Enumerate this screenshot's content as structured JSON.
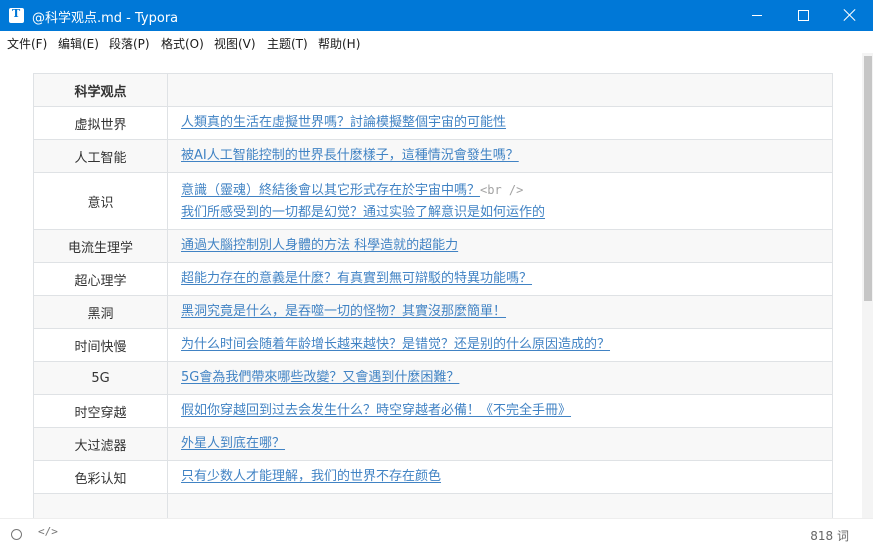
{
  "window": {
    "title": "@科学观点.md - Typora",
    "icon_letter": "T",
    "minimize_icon": "minimize-icon",
    "maximize_icon": "maximize-icon",
    "close_icon": "close-icon"
  },
  "menu": [
    "文件(F)",
    "编辑(E)",
    "段落(P)",
    "格式(O)",
    "视图(V)",
    "主题(T)",
    "帮助(H)"
  ],
  "table": {
    "header": [
      "科学观点",
      ""
    ],
    "rows": [
      {
        "name": "虚拟世界",
        "links": [
          "人類真的生活在虛擬世界嗎？討論模擬整個宇宙的可能性"
        ]
      },
      {
        "name": "人工智能",
        "links": [
          "被AI人工智能控制的世界長什麽樣子，這種情況會發生嗎？"
        ]
      },
      {
        "name": "意识",
        "links": [
          "意識（靈魂）終結後會以其它形式存在於宇宙中嗎？",
          "我们所感受到的一切都是幻觉？通过实验了解意识是如何运作的"
        ],
        "br": "<br />"
      },
      {
        "name": "电流生理学",
        "links": [
          "通過大腦控制別人身體的方法 科學造就的超能力"
        ]
      },
      {
        "name": "超心理学",
        "links": [
          "超能力存在的意義是什麼？有真實到無可辯駁的特異功能嗎？"
        ]
      },
      {
        "name": "黑洞",
        "links": [
          "黑洞究竟是什么，是吞噬一切的怪物？其實沒那麼簡單！"
        ]
      },
      {
        "name": "时间快慢",
        "links": [
          "为什么时间会随着年龄增长越来越快？是错觉？还是别的什么原因造成的？"
        ]
      },
      {
        "name": "5G",
        "links": [
          "5G會為我們帶來哪些改變？又會遇到什麼困難？"
        ]
      },
      {
        "name": "时空穿越",
        "links": [
          "假如你穿越回到过去会发生什么？時空穿越者必備！《不完全手冊》"
        ]
      },
      {
        "name": "大过滤器",
        "links": [
          "外星人到底在哪？"
        ]
      },
      {
        "name": "色彩认知",
        "links": [
          "只有少数人才能理解，我们的世界不存在颜色"
        ]
      },
      {
        "name": "",
        "links": []
      }
    ]
  },
  "status": {
    "source_icon": "source-code-icon",
    "outline_icon": "circle-icon",
    "word_count": "818 词"
  },
  "colors": {
    "titlebar": "#0078d7",
    "link": "#4183c4",
    "table_border": "#dfe2e5",
    "row_alt": "#f8f8f8"
  }
}
